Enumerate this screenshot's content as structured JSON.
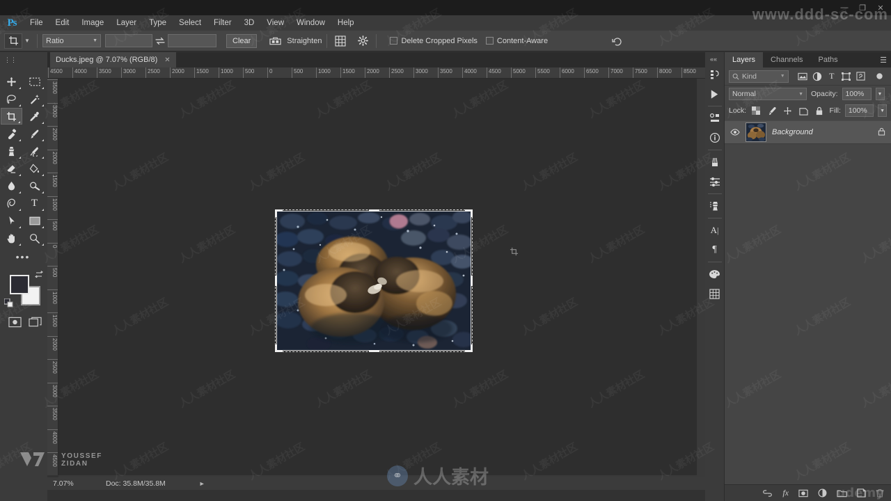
{
  "window": {
    "watermark_top": "www.ddd-sc-com",
    "controls": [
      "minimize-icon",
      "restore-icon",
      "close-icon"
    ]
  },
  "menubar": {
    "logo": "Ps",
    "items": [
      "File",
      "Edit",
      "Image",
      "Layer",
      "Type",
      "Select",
      "Filter",
      "3D",
      "View",
      "Window",
      "Help"
    ]
  },
  "options_bar": {
    "tool_icon": "crop-tool-icon",
    "ratio_label": "Ratio",
    "width_value": "",
    "height_value": "",
    "width_placeholder": "",
    "height_placeholder": "",
    "swap_icon": "swap-arrows-icon",
    "clear_label": "Clear",
    "straighten_label": "Straighten",
    "straighten_icon": "straighten-icon",
    "overlay_icon": "grid-overlay-icon",
    "settings_icon": "gear-icon",
    "delete_cropped_label": "Delete Cropped Pixels",
    "delete_cropped_checked": false,
    "content_aware_label": "Content-Aware",
    "content_aware_checked": false,
    "reset_icon": "reset-arrow-icon"
  },
  "document": {
    "tab_title": "Ducks.jpeg @ 7.07% (RGB/8)",
    "close_icon": "close-icon"
  },
  "toolbar": {
    "tools": [
      {
        "name": "move-tool",
        "icon": "move-icon",
        "selected": false
      },
      {
        "name": "marquee-tool",
        "icon": "rectangular-marquee-icon",
        "selected": false
      },
      {
        "name": "lasso-tool",
        "icon": "lasso-icon",
        "selected": false
      },
      {
        "name": "magic-wand-tool",
        "icon": "magic-wand-icon",
        "selected": false
      },
      {
        "name": "crop-tool",
        "icon": "crop-icon",
        "selected": true
      },
      {
        "name": "eyedropper-tool",
        "icon": "eyedropper-icon",
        "selected": false
      },
      {
        "name": "healing-brush-tool",
        "icon": "spot-healing-icon",
        "selected": false
      },
      {
        "name": "brush-tool",
        "icon": "brush-icon",
        "selected": false
      },
      {
        "name": "clone-stamp-tool",
        "icon": "stamp-icon",
        "selected": false
      },
      {
        "name": "history-brush-tool",
        "icon": "history-brush-icon",
        "selected": false
      },
      {
        "name": "eraser-tool",
        "icon": "eraser-icon",
        "selected": false
      },
      {
        "name": "gradient-tool",
        "icon": "paint-bucket-icon",
        "selected": false
      },
      {
        "name": "blur-tool",
        "icon": "blur-drop-icon",
        "selected": false
      },
      {
        "name": "dodge-tool",
        "icon": "dodge-icon",
        "selected": false
      },
      {
        "name": "pen-tool",
        "icon": "pen-icon",
        "selected": false
      },
      {
        "name": "type-tool",
        "icon": "type-T-icon",
        "selected": false
      },
      {
        "name": "path-selection-tool",
        "icon": "path-arrow-icon",
        "selected": false
      },
      {
        "name": "shape-tool",
        "icon": "rectangle-shape-icon",
        "selected": false
      },
      {
        "name": "hand-tool",
        "icon": "hand-icon",
        "selected": false
      },
      {
        "name": "zoom-tool",
        "icon": "magnifier-icon",
        "selected": false
      }
    ],
    "more_icon": "more-tools-icon",
    "foreground_color": "#2b2b33",
    "background_color": "#f2f2f2",
    "swap_colors_icon": "swap-colors-icon",
    "default_colors_icon": "default-colors-icon",
    "quickmask_icon": "quick-mask-icon",
    "screenmode_icon": "screen-mode-icon"
  },
  "rulers": {
    "unit": "px",
    "horizontal_ticks": [
      "4500",
      "4000",
      "3500",
      "3000",
      "2500",
      "2000",
      "1500",
      "1000",
      "500",
      "0",
      "500",
      "1000",
      "1500",
      "2000",
      "2500",
      "3000",
      "3500",
      "4000",
      "4500",
      "5000",
      "5500",
      "6000",
      "6500",
      "7000",
      "7500",
      "8000",
      "8500"
    ],
    "vertical_ticks": [
      "3500",
      "3000",
      "2500",
      "2000",
      "1500",
      "1000",
      "500",
      "0",
      "500",
      "1000",
      "1500",
      "2000",
      "2500",
      "3000",
      "3500",
      "4000",
      "4500"
    ]
  },
  "canvas": {
    "image_alt": "three-ducklings-on-pebbles",
    "crop_active": true,
    "crop_handles": [
      "top-left",
      "top-center",
      "top-right",
      "middle-left",
      "middle-right",
      "bottom-left",
      "bottom-center",
      "bottom-right"
    ],
    "cursor_icon": "crop-cursor"
  },
  "right_rail": {
    "icons": [
      "history-panel-icon",
      "actions-panel-icon",
      "properties-panel-icon",
      "info-panel-icon",
      "brush-panel-icon",
      "brush-settings-icon",
      "clone-source-icon",
      "character-panel-icon",
      "paragraph-panel-icon",
      "color-swatches-icon",
      "libraries-panel-icon"
    ],
    "expand_icon": "expand-dock-icon"
  },
  "layers_panel": {
    "tabs": [
      {
        "label": "Layers",
        "active": true
      },
      {
        "label": "Channels",
        "active": false
      },
      {
        "label": "Paths",
        "active": false
      }
    ],
    "menu_icon": "panel-menu-icon",
    "filter": {
      "search_icon": "search-icon",
      "kind_label": "Kind",
      "type_filters": [
        "pixel-filter-icon",
        "adjustment-filter-icon",
        "type-filter-icon",
        "shape-filter-icon",
        "smart-object-filter-icon"
      ],
      "toggle_icon": "filter-toggle-icon"
    },
    "blend_mode": "Normal",
    "opacity_label": "Opacity:",
    "opacity_value": "100%",
    "lock_label": "Lock:",
    "lock_icons": [
      "lock-transparent-icon",
      "lock-image-icon",
      "lock-position-icon",
      "lock-artboard-icon",
      "lock-all-icon"
    ],
    "fill_label": "Fill:",
    "fill_value": "100%",
    "layers": [
      {
        "name": "Background",
        "visible": true,
        "locked": true,
        "visibility_icon": "eye-icon",
        "lock_icon": "lock-icon",
        "thumbnail": "ducklings-thumbnail"
      }
    ],
    "footer_icons": [
      "link-layers-icon",
      "fx-icon",
      "add-mask-icon",
      "adjustment-layer-icon",
      "new-group-icon",
      "new-layer-icon",
      "delete-layer-icon"
    ]
  },
  "status_bar": {
    "zoom": "7.07%",
    "doc_label": "Doc: 35.8M/35.8M",
    "expand_icon": "status-arrow-icon"
  },
  "overlays": {
    "chinese_watermark": "人人素材",
    "udemy_watermark": "udemy",
    "author_line1": "YOUSSEF",
    "author_line2": "ZIDAN",
    "tile_watermark": "人人素材社区"
  },
  "colors": {
    "accent": "#31a8e8",
    "panel_bg": "#454545",
    "app_bg": "#323232",
    "canvas_bg": "#2e2e2e",
    "toolbar_bg": "#3b3b3b"
  }
}
